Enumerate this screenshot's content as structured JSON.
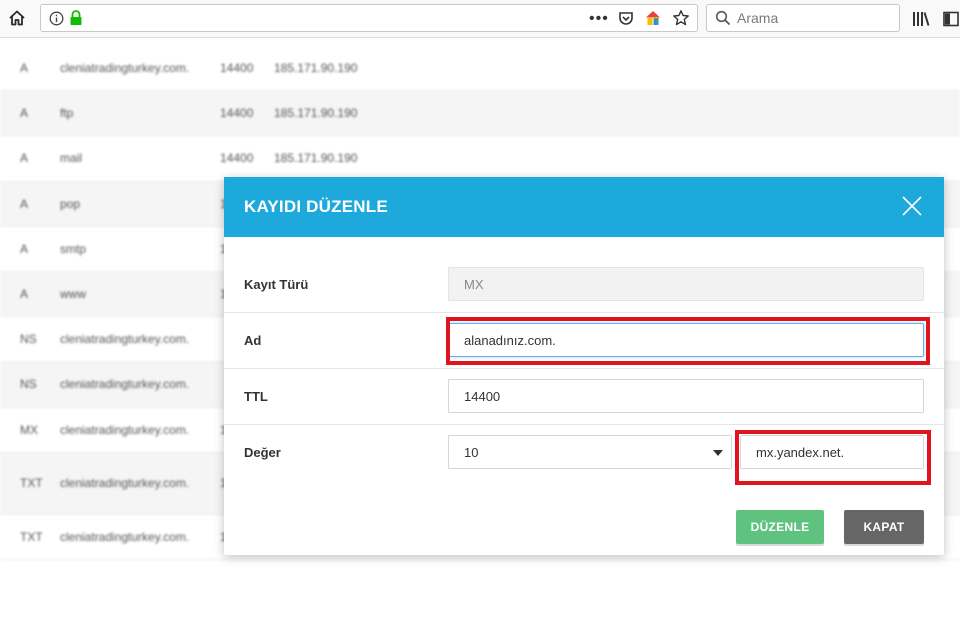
{
  "browser": {
    "search_placeholder": "Arama"
  },
  "background_rows": [
    {
      "type": "A",
      "name": "cleniatradingturkey.com.",
      "ttl": "14400",
      "value": "185.171.90.190"
    },
    {
      "type": "A",
      "name": "ftp",
      "ttl": "14400",
      "value": "185.171.90.190"
    },
    {
      "type": "A",
      "name": "mail",
      "ttl": "14400",
      "value": "185.171.90.190"
    },
    {
      "type": "A",
      "name": "pop",
      "ttl": "1",
      "value": ""
    },
    {
      "type": "A",
      "name": "smtp",
      "ttl": "1",
      "value": ""
    },
    {
      "type": "A",
      "name": "www",
      "ttl": "1",
      "value": ""
    },
    {
      "type": "NS",
      "name": "cleniatradingturkey.com.",
      "ttl": "",
      "value": ""
    },
    {
      "type": "NS",
      "name": "cleniatradingturkey.com.",
      "ttl": "",
      "value": ""
    },
    {
      "type": "MX",
      "name": "cleniatradingturkey.com.",
      "ttl": "1",
      "value": ""
    },
    {
      "type": "TXT",
      "name": "cleniatradingturkey.com.",
      "ttl": "1",
      "value": ""
    },
    {
      "type": "TXT",
      "name": "cleniatradingturkey.com.",
      "ttl": "1",
      "value": ""
    }
  ],
  "modal": {
    "title": "KAYIDI DÜZENLE",
    "record_type_label": "Kayıt Türü",
    "record_type_value": "MX",
    "name_label": "Ad",
    "name_value": "alanadınız.com.",
    "ttl_label": "TTL",
    "ttl_value": "14400",
    "value_label": "Değer",
    "priority_value": "10",
    "host_value": "mx.yandex.net.",
    "edit_button": "DÜZENLE",
    "close_button": "KAPAT"
  },
  "colors": {
    "header": "#1ea9dc",
    "highlight": "#e0141c",
    "edit_button": "#5fc27e",
    "close_button": "#666666"
  }
}
